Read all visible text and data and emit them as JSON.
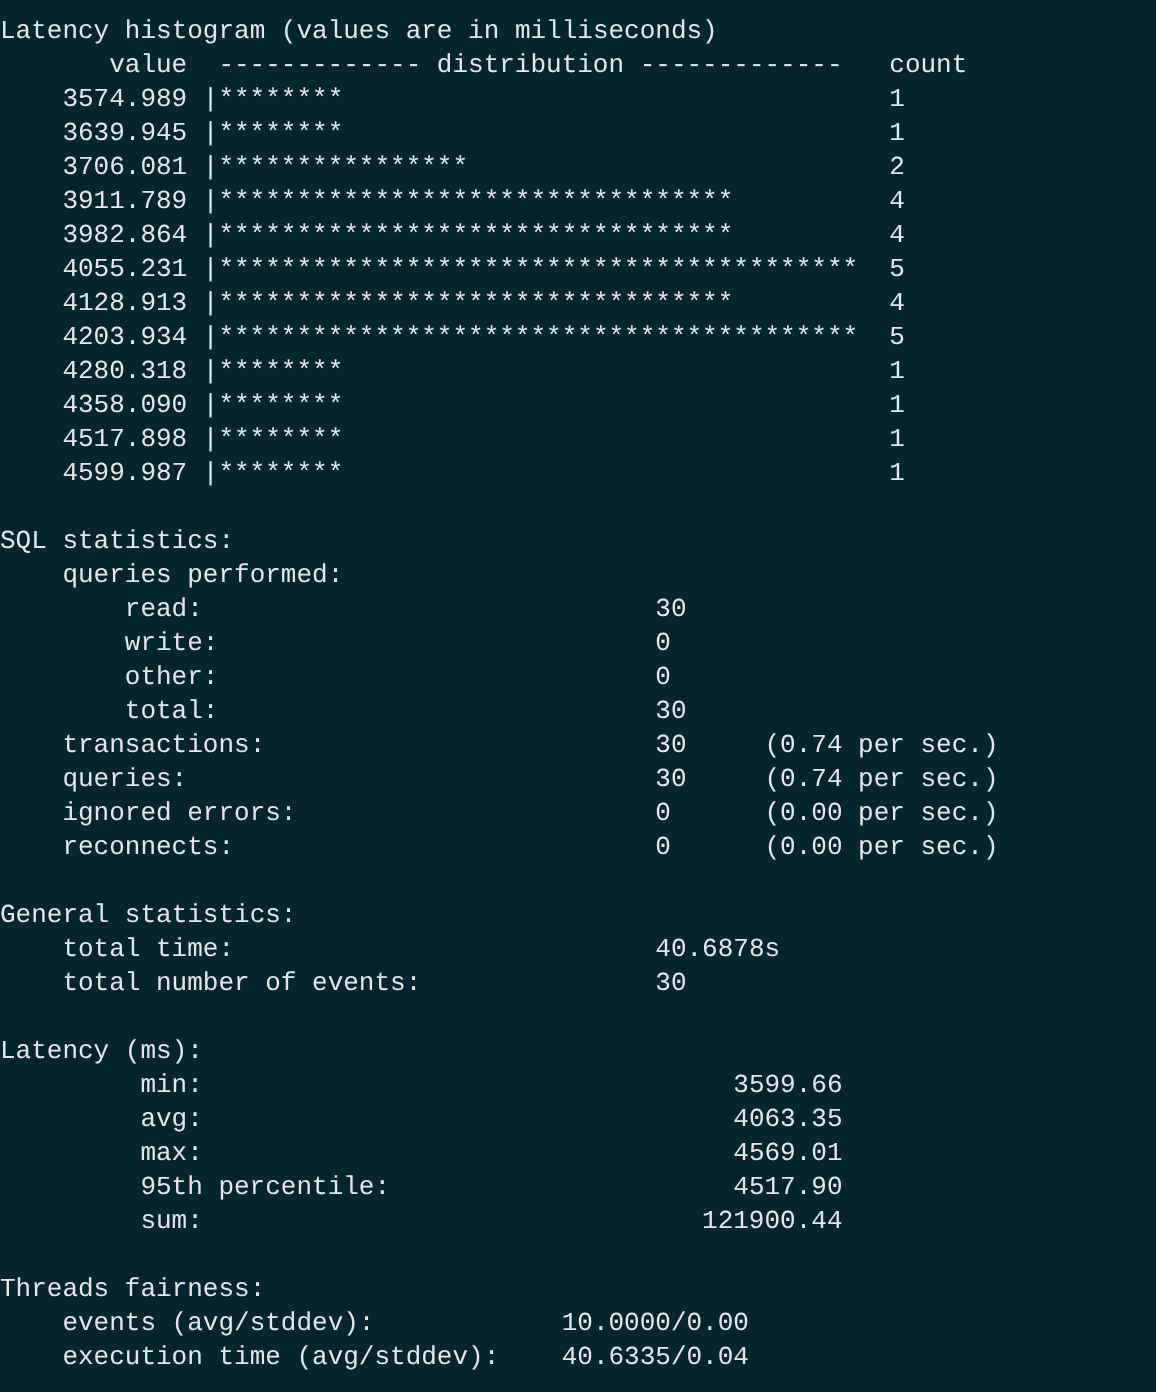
{
  "histogram": {
    "title": "Latency histogram (values are in milliseconds)",
    "headers": {
      "value": "value",
      "distribution": "------------- distribution -------------",
      "count": "count"
    },
    "rows": [
      {
        "value": "3574.989",
        "bar": "|********",
        "count": "1"
      },
      {
        "value": "3639.945",
        "bar": "|********",
        "count": "1"
      },
      {
        "value": "3706.081",
        "bar": "|****************",
        "count": "2"
      },
      {
        "value": "3911.789",
        "bar": "|*********************************",
        "count": "4"
      },
      {
        "value": "3982.864",
        "bar": "|*********************************",
        "count": "4"
      },
      {
        "value": "4055.231",
        "bar": "|*****************************************",
        "count": "5"
      },
      {
        "value": "4128.913",
        "bar": "|*********************************",
        "count": "4"
      },
      {
        "value": "4203.934",
        "bar": "|*****************************************",
        "count": "5"
      },
      {
        "value": "4280.318",
        "bar": "|********",
        "count": "1"
      },
      {
        "value": "4358.090",
        "bar": "|********",
        "count": "1"
      },
      {
        "value": "4517.898",
        "bar": "|********",
        "count": "1"
      },
      {
        "value": "4599.987",
        "bar": "|********",
        "count": "1"
      }
    ]
  },
  "sql_statistics": {
    "title": "SQL statistics:",
    "queries_performed": {
      "label": "queries performed:",
      "rows": [
        {
          "label": "read:",
          "value": "30"
        },
        {
          "label": "write:",
          "value": "0"
        },
        {
          "label": "other:",
          "value": "0"
        },
        {
          "label": "total:",
          "value": "30"
        }
      ]
    },
    "rows": [
      {
        "label": "transactions:",
        "value": "30",
        "rate": "(0.74 per sec.)"
      },
      {
        "label": "queries:",
        "value": "30",
        "rate": "(0.74 per sec.)"
      },
      {
        "label": "ignored errors:",
        "value": "0",
        "rate": "(0.00 per sec.)"
      },
      {
        "label": "reconnects:",
        "value": "0",
        "rate": "(0.00 per sec.)"
      }
    ]
  },
  "general_statistics": {
    "title": "General statistics:",
    "rows": [
      {
        "label": "total time:",
        "value": "40.6878s"
      },
      {
        "label": "total number of events:",
        "value": "30"
      }
    ]
  },
  "latency": {
    "title": "Latency (ms):",
    "rows": [
      {
        "label": "min:",
        "value": "3599.66"
      },
      {
        "label": "avg:",
        "value": "4063.35"
      },
      {
        "label": "max:",
        "value": "4569.01"
      },
      {
        "label": "95th percentile:",
        "value": "4517.90"
      },
      {
        "label": "sum:",
        "value": "121900.44"
      }
    ]
  },
  "threads_fairness": {
    "title": "Threads fairness:",
    "rows": [
      {
        "label": "events (avg/stddev):",
        "value": "10.0000/0.00"
      },
      {
        "label": "execution time (avg/stddev):",
        "value": "40.6335/0.04"
      }
    ]
  }
}
